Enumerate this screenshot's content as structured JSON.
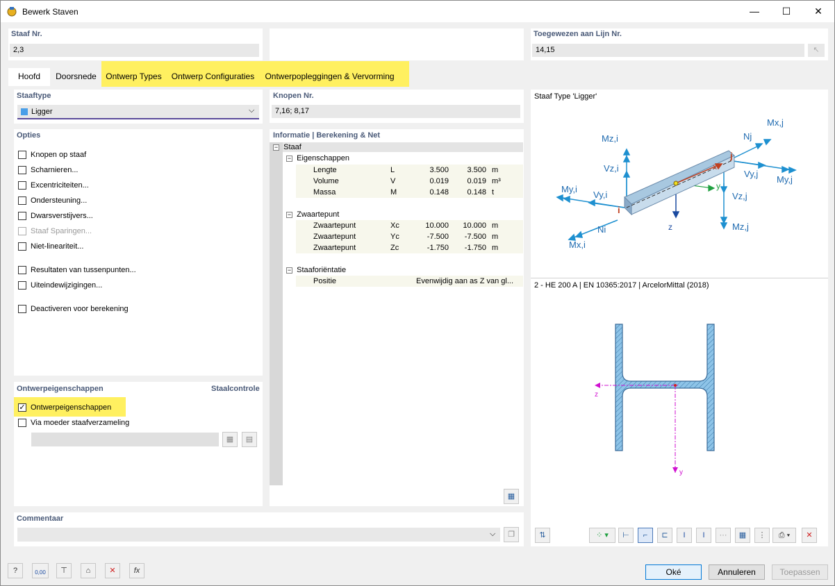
{
  "window": {
    "title": "Bewerk Staven",
    "minimize": "—",
    "maximize": "☐",
    "close": "✕"
  },
  "staaf_nr": {
    "label": "Staaf Nr.",
    "value": "2,3"
  },
  "toegewezen": {
    "label": "Toegewezen aan Lijn Nr.",
    "value": "14,15"
  },
  "tabs": [
    {
      "label": "Hoofd"
    },
    {
      "label": "Doorsnede"
    },
    {
      "label": "Ontwerp Types"
    },
    {
      "label": "Ontwerp Configuraties"
    },
    {
      "label": "Ontwerpopleggingen & Vervorming"
    }
  ],
  "staaftype": {
    "label": "Staaftype",
    "value": "Ligger",
    "color": "#4a9fe8"
  },
  "opties": {
    "label": "Opties",
    "items": [
      {
        "label": "Knopen op staaf"
      },
      {
        "label": "Scharnieren..."
      },
      {
        "label": "Excentriciteiten..."
      },
      {
        "label": "Ondersteuning..."
      },
      {
        "label": "Dwarsverstijvers..."
      },
      {
        "label": "Staaf Sparingen..."
      },
      {
        "label": "Niet-lineariteit..."
      },
      {
        "label": "Resultaten van tussenpunten..."
      },
      {
        "label": "Uiteindewijzigingen..."
      },
      {
        "label": "Deactiveren voor berekening"
      }
    ]
  },
  "ontwerp": {
    "label": "Ontwerpeigenschappen",
    "right_label": "Staalcontrole",
    "check1": "Ontwerpeigenschappen",
    "check2": "Via moeder staafverzameling"
  },
  "knopen": {
    "label": "Knopen Nr.",
    "value": "7,16; 8,17"
  },
  "info": {
    "label": "Informatie | Berekening & Net",
    "staaf": "Staaf",
    "eigenschappen": "Eigenschappen",
    "rows1": [
      {
        "name": "Lengte",
        "sym": "L",
        "v1": "3.500",
        "v2": "3.500",
        "unit": "m"
      },
      {
        "name": "Volume",
        "sym": "V",
        "v1": "0.019",
        "v2": "0.019",
        "unit": "m³"
      },
      {
        "name": "Massa",
        "sym": "M",
        "v1": "0.148",
        "v2": "0.148",
        "unit": "t"
      }
    ],
    "zwaartepunt": "Zwaartepunt",
    "rows2": [
      {
        "name": "Zwaartepunt",
        "sym": "Xc",
        "v1": "10.000",
        "v2": "10.000",
        "unit": "m"
      },
      {
        "name": "Zwaartepunt",
        "sym": "Yc",
        "v1": "-7.500",
        "v2": "-7.500",
        "unit": "m"
      },
      {
        "name": "Zwaartepunt",
        "sym": "Zc",
        "v1": "-1.750",
        "v2": "-1.750",
        "unit": "m"
      }
    ],
    "orientatie": "Staaforiëntatie",
    "positie": {
      "name": "Positie",
      "value": "Evenwijdig aan as Z van gl..."
    }
  },
  "diagram": {
    "title": "Staaf Type 'Ligger'",
    "labels": {
      "mzi": "Mz,i",
      "vzi": "Vz,i",
      "myi": "My,i",
      "vyi": "Vy,i",
      "ni": "Ni",
      "mxi": "Mx,i",
      "nj": "Nj",
      "mxj": "Mx,j",
      "vyj": "Vy,j",
      "myj": "My,j",
      "vzj": "Vz,j",
      "mzj": "Mz,j",
      "i": "i",
      "j": "j",
      "x": "x",
      "y": "y",
      "z": "z"
    }
  },
  "section": {
    "title": "2 - HE 200 A | EN 10365:2017 | ArcelorMittal (2018)",
    "z": "z",
    "y": "y"
  },
  "commentaar": {
    "label": "Commentaar"
  },
  "buttons": {
    "ok": "Oké",
    "cancel": "Annuleren",
    "apply": "Toepassen"
  },
  "bottom_icons": {
    "units": "0,00",
    "fx": "fx"
  },
  "colors": {
    "highlight": "#fff060",
    "accent": "#1e90d0",
    "frame": "#4a5a78"
  }
}
